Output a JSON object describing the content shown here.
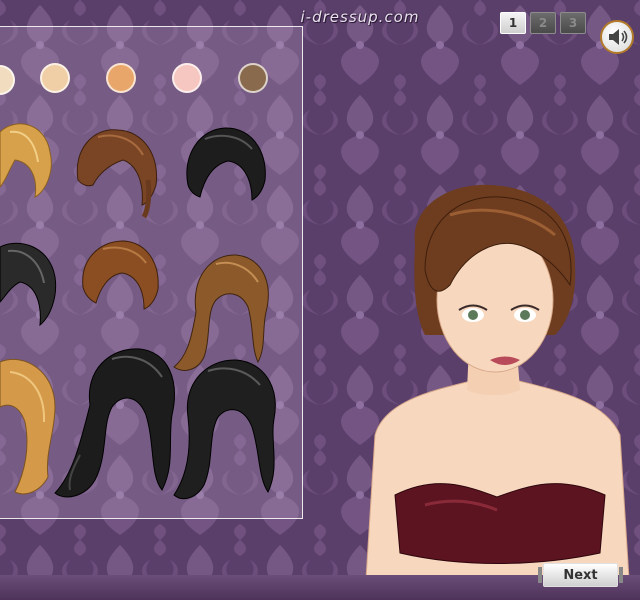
{
  "brand": {
    "logo_text": "i-dressup.com"
  },
  "pagination": {
    "pages": [
      "1",
      "2",
      "3"
    ],
    "active": "1"
  },
  "sound": {
    "icon": "speaker-icon"
  },
  "skin_tones": [
    "#f2dcc0",
    "#f1cfa6",
    "#e9a66a",
    "#f6c6c0",
    "#8a6a4c"
  ],
  "hair_styles": [
    {
      "color": "#d7a04a"
    },
    {
      "color": "#7a4525"
    },
    {
      "color": "#1d1d1d"
    },
    {
      "color": "#2a2a2a"
    },
    {
      "color": "#8a4e22"
    },
    {
      "color": "#8c5a2a"
    },
    {
      "color": "#d49a4a"
    },
    {
      "color": "#1c1c1c"
    },
    {
      "color": "#1f1f1f"
    }
  ],
  "model": {
    "hair_color": "#6e3c1e",
    "skin": "#f7d8bf",
    "top_color": "#5c1420"
  },
  "navigation": {
    "next_label": "Next"
  }
}
